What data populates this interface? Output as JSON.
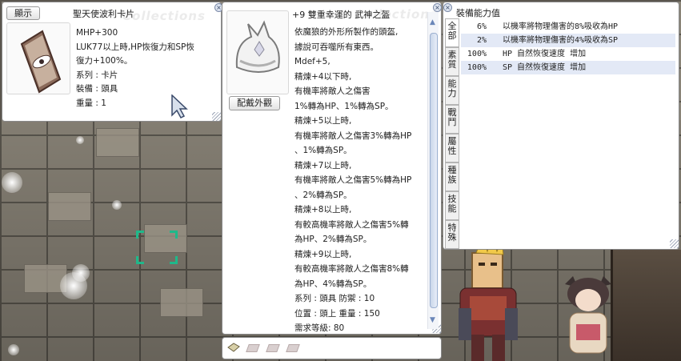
{
  "card_window": {
    "display_button": "顯示",
    "title": "聖天使波利卡片",
    "watermark": "Collections",
    "lines": [
      "MHP+300",
      "LUK77以上時,HP恢復力和SP恢",
      "復力+100%。",
      "系列 : 卡片",
      "裝備 : 頭具",
      "重量 : 1"
    ]
  },
  "item_window": {
    "title": "+9 雙重幸運的 武神之盔",
    "watermark": "Collections",
    "appearance_button": "配戴外觀",
    "lines": [
      "依魔狼的外形所製作的頭盔,",
      "據說可吞噬所有東西。",
      "Mdef+5,",
      "精煉+4以下時,",
      "有機率將敵人之傷害",
      "1%轉為HP、1%轉為SP。",
      "精煉+5以上時,",
      "有機率將敵人之傷害3%轉為HP",
      "、1%轉為SP。",
      "精煉+7以上時,",
      "有機率將敵人之傷害5%轉為HP",
      "、2%轉為SP。",
      "精煉+8以上時,",
      "有較高機率將敵人之傷害5%轉",
      "為HP、2%轉為SP。",
      "精煉+9以上時,",
      "有較高機率將敵人之傷害8%轉",
      "為HP、4%轉為SP。",
      "系列 : 頭具 防禦 : 10",
      "位置 : 頭上 重量 : 150",
      "需求等級: 80"
    ]
  },
  "stat_window": {
    "title": "裝備能力值",
    "tabs": [
      "全部",
      "素質",
      "能力",
      "戰鬥",
      "屬性",
      "種族",
      "技能",
      "特殊"
    ],
    "rows": [
      {
        "pct": "6%",
        "text": "以機率將物理傷害的8%吸收為HP"
      },
      {
        "pct": "2%",
        "text": "以機率將物理傷害的4%吸收為SP"
      },
      {
        "pct": "100%",
        "text": "HP 自然恢復速度 增加"
      },
      {
        "pct": "100%",
        "text": "SP 自然恢復速度 增加"
      }
    ]
  },
  "colors": {
    "highlight_row": "#e3e9f6",
    "window_bg": "#ffffff",
    "accent": "#1fb88a"
  }
}
